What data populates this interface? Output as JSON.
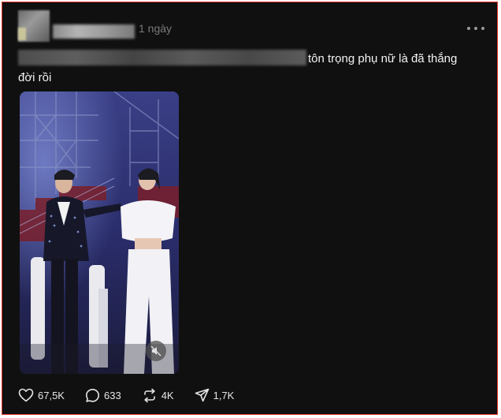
{
  "post": {
    "timestamp": "1 ngày",
    "caption_text": "tôn trọng phụ nữ là đã thắng đời rồi"
  },
  "actions": {
    "likes": "67,5K",
    "comments": "633",
    "reposts": "4K",
    "shares": "1,7K"
  },
  "colors": {
    "background": "#101010",
    "text": "#f3f3f3",
    "muted": "#7a7a7a",
    "frame_border": "#e0302a"
  },
  "icons": {
    "more": "more-horizontal-icon",
    "like": "heart-icon",
    "comment": "speech-bubble-icon",
    "repost": "repost-icon",
    "share": "paper-plane-icon",
    "mute": "speaker-muted-icon"
  }
}
